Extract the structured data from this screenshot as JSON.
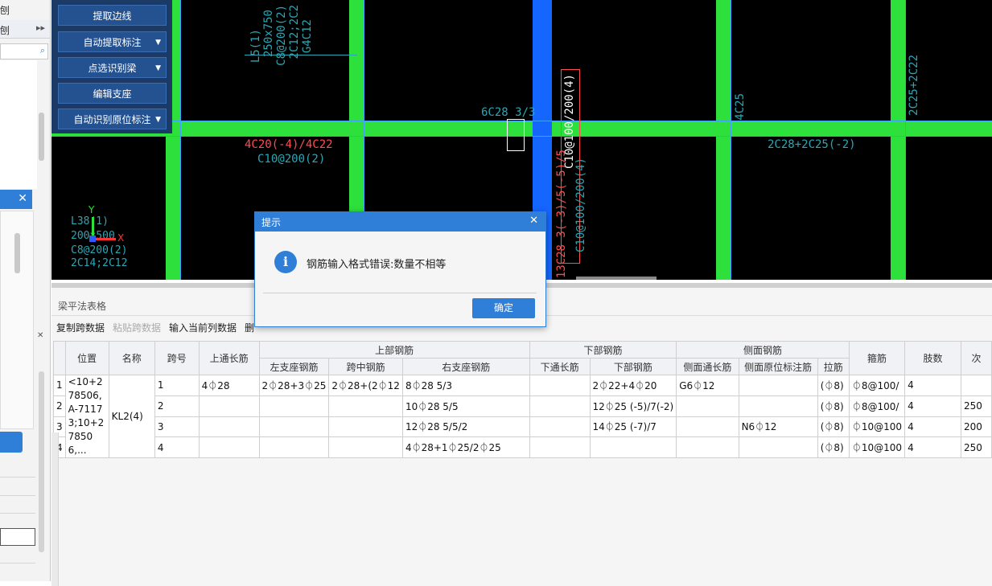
{
  "left_panel": {
    "title_fragment": "刨",
    "collapse_icon": "double-chevron-right-icon",
    "search_icon": "search-icon",
    "close_icon": "close-icon"
  },
  "toolbar": {
    "items": [
      {
        "label": "提取边线",
        "dropdown": false
      },
      {
        "label": "自动提取标注",
        "dropdown": true
      },
      {
        "label": "点选识别梁",
        "dropdown": true
      },
      {
        "label": "编辑支座",
        "dropdown": false
      },
      {
        "label": "自动识别原位标注",
        "dropdown": true
      }
    ]
  },
  "cad": {
    "t1": "L5(1)",
    "t2": "250x750",
    "t3": "C8@200(2)",
    "t4": "2C12;2C2",
    "t5": "G4C12",
    "t6": "6C28 3/3",
    "t7": "4C20(-4)/4C22",
    "t8": "C10@200(2)",
    "t9": "4C25",
    "t10": "2C25+2C22",
    "t11": "2C28+2C25(-2)",
    "t12": "C10@100/200(4)",
    "t13": "13C28 3(-3)/5(-5)/5",
    "t14": "C10@100/200(4)",
    "t15": "L38(1)",
    "t16": "200x500",
    "t17": "C8@200(2)",
    "t18": "2C14;2C12",
    "axis_y": "Y",
    "axis_x": "X"
  },
  "grid_panel": {
    "title": "梁平法表格",
    "toolbar": [
      "复制跨数据",
      "粘贴跨数据",
      "输入当前列数据",
      "删"
    ],
    "group_headers": [
      "上部钢筋",
      "下部钢筋",
      "侧面钢筋"
    ],
    "headers": [
      "位置",
      "名称",
      "跨号",
      "上通长筋",
      "左支座钢筋",
      "跨中钢筋",
      "右支座钢筋",
      "下通长筋",
      "下部钢筋",
      "侧面通长筋",
      "侧面原位标注筋",
      "拉筋",
      "箍筋",
      "肢数",
      "次"
    ],
    "position_value": "<10+278506,A-71173;10+278506,...",
    "name_value": "KL2(4)",
    "rows": [
      {
        "idx": "1",
        "span": "1",
        "top_through": "4⏀28",
        "left_support": "2⏀28+3⏀25",
        "mid": "2⏀28+(2⏀12",
        "right_support": "8⏀28 5/3",
        "bottom_through": "",
        "bottom": "2⏀22+4⏀20",
        "side_through": "G6⏀12",
        "side_in_situ": "",
        "tie": "(⏀8)",
        "stirrup": "⏀8@100/",
        "legs": "4",
        "extra": ""
      },
      {
        "idx": "2",
        "span": "2",
        "top_through": "",
        "left_support": "",
        "mid": "",
        "right_support": "10⏀28 5/5",
        "bottom_through": "",
        "bottom": "12⏀25 (-5)/7(-2)",
        "side_through": "",
        "side_in_situ": "",
        "tie": "(⏀8)",
        "stirrup": "⏀8@100/",
        "legs": "4",
        "extra": "250"
      },
      {
        "idx": "3",
        "span": "3",
        "top_through": "",
        "left_support": "",
        "mid": "",
        "right_support": "12⏀28 5/5/2",
        "bottom_through": "",
        "bottom": "14⏀25 (-7)/7",
        "side_through": "",
        "side_in_situ": "N6⏀12",
        "tie": "(⏀8)",
        "stirrup": "⏀10@100",
        "legs": "4",
        "extra": "200"
      },
      {
        "idx": "4",
        "span": "4",
        "top_through": "",
        "left_support": "",
        "mid": "",
        "right_support": "4⏀28+1⏀25/2⏀25",
        "bottom_through": "",
        "bottom": "",
        "side_through": "",
        "side_in_situ": "",
        "tie": "(⏀8)",
        "stirrup": "⏀10@100",
        "legs": "4",
        "extra": "250"
      }
    ]
  },
  "dialog": {
    "title": "提示",
    "message": "钢筋输入格式错误:数量不相等",
    "ok": "确定",
    "icon": "info-icon"
  },
  "colors": {
    "accent": "#2f7fd8",
    "beam_green": "#2ee03c",
    "column_blue": "#1565ff",
    "cad_text": "#2aa7b5",
    "cad_red": "#ff4d4d"
  }
}
